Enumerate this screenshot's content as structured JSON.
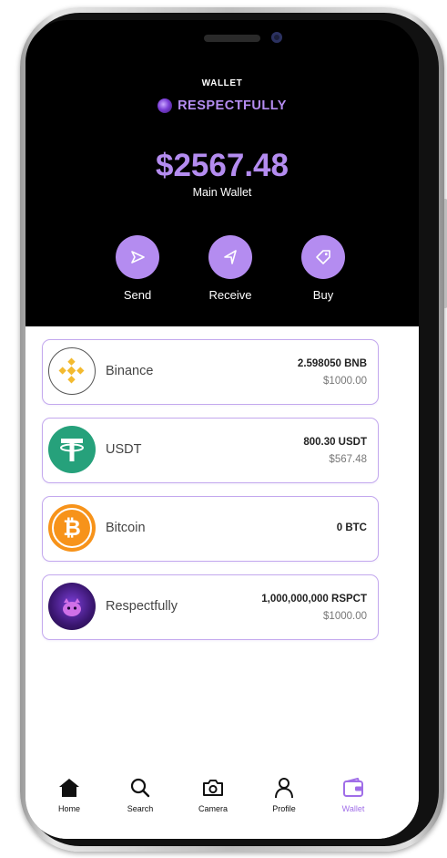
{
  "header": {
    "title": "WALLET",
    "brand_name": "RESPECTFULLY"
  },
  "balance": {
    "amount": "$2567.48",
    "label": "Main Wallet"
  },
  "actions": [
    {
      "label": "Send",
      "icon": "send-icon"
    },
    {
      "label": "Receive",
      "icon": "receive-icon"
    },
    {
      "label": "Buy",
      "icon": "tag-icon"
    }
  ],
  "coins": [
    {
      "name": "Binance",
      "amount": "2.598050 BNB",
      "usd": "$1000.00",
      "icon": "binance-icon"
    },
    {
      "name": "USDT",
      "amount": "800.30 USDT",
      "usd": "$567.48",
      "icon": "tether-icon"
    },
    {
      "name": "Bitcoin",
      "amount": "0 BTC",
      "usd": "",
      "icon": "bitcoin-icon"
    },
    {
      "name": "Respectfully",
      "amount": "1,000,000,000 RSPCT",
      "usd": "$1000.00",
      "icon": "respectfully-icon"
    }
  ],
  "nav": {
    "items": [
      {
        "label": "Home",
        "icon": "home-icon"
      },
      {
        "label": "Search",
        "icon": "search-icon"
      },
      {
        "label": "Camera",
        "icon": "camera-icon"
      },
      {
        "label": "Profile",
        "icon": "profile-icon"
      },
      {
        "label": "Wallet",
        "icon": "wallet-icon",
        "active": true
      }
    ]
  },
  "colors": {
    "accent": "#b48cf0",
    "header_bg": "#000000",
    "card_border": "#c3a8ee",
    "active_nav": "#a06ee8"
  }
}
